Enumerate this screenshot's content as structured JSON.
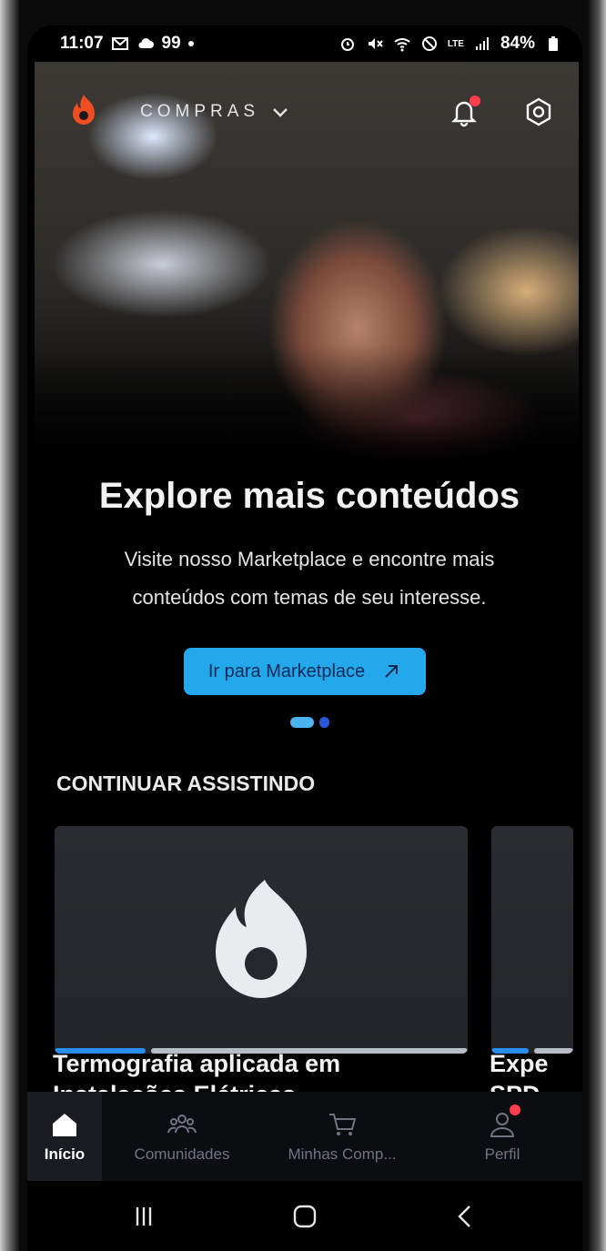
{
  "status_bar": {
    "time": "11:07",
    "left_indicator": "99",
    "battery": "84%",
    "network": "LTE"
  },
  "header": {
    "section_label": "COMPRAS",
    "notification_badge": true
  },
  "hero": {
    "title": "Explore mais conteúdos",
    "subtitle": "Visite nosso Marketplace e encontre mais conteúdos com temas de seu interesse.",
    "button_label": "Ir para Marketplace",
    "carousel_index": 1,
    "carousel_count": 2
  },
  "continue_watching": {
    "title": "CONTINUAR ASSISTINDO",
    "items": [
      {
        "title": "Termografia aplicada em",
        "title_line2": "Instalações Elétricas",
        "progress": 0.22
      },
      {
        "title": "Expe",
        "title_line2": "SPD",
        "progress": 0.5
      }
    ]
  },
  "bottom_nav": {
    "items": [
      {
        "label": "Início",
        "active": true
      },
      {
        "label": "Comunidades",
        "active": false
      },
      {
        "label": "Minhas Comp...",
        "active": false
      },
      {
        "label": "Perfil",
        "active": false,
        "badge": true
      }
    ]
  },
  "colors": {
    "accent": "#23a8ec",
    "brand_orange": "#ef4e23",
    "badge_red": "#ff3d4c",
    "progress_blue": "#2a8df0"
  },
  "icons": [
    "mail-icon",
    "cloud-icon",
    "alarm-icon",
    "mute-icon",
    "wifi-icon",
    "block-icon",
    "signal-icon",
    "battery-icon",
    "bell-icon",
    "settings-icon",
    "chevron-down-icon",
    "external-link-icon",
    "home-icon",
    "people-icon",
    "cart-icon",
    "user-icon",
    "recents-icon",
    "home-circle-icon",
    "back-icon"
  ]
}
